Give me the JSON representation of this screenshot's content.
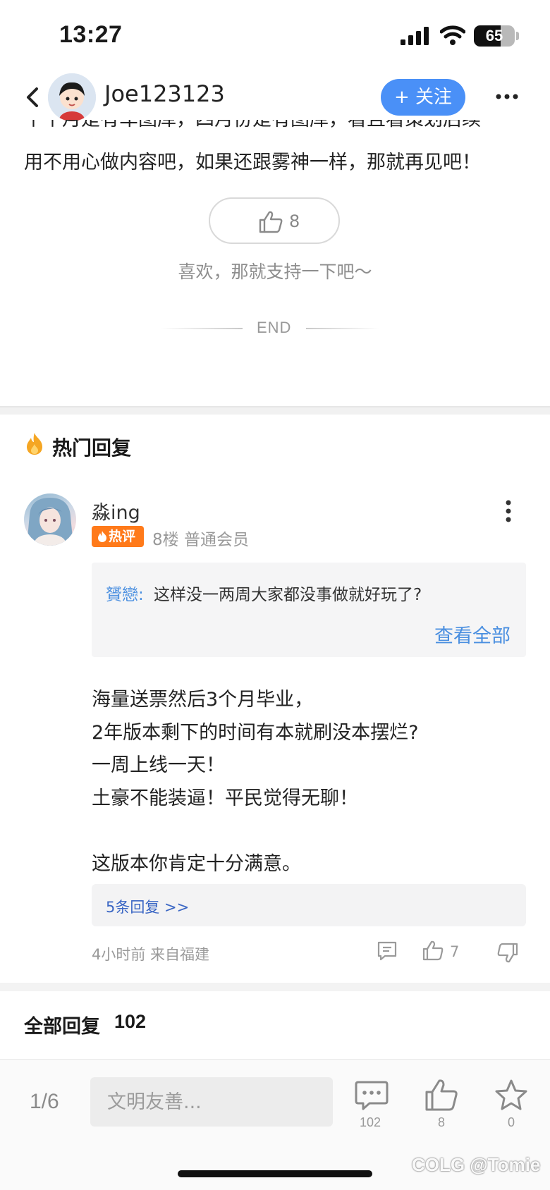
{
  "status_bar": {
    "time": "13:27",
    "battery": "65"
  },
  "header": {
    "author_name": "Joe123123",
    "follow_label": "+ 关注"
  },
  "article": {
    "cut_line": "个个月是有车图库，四月份是有图库，看且看策划后续",
    "last_line": "用不用心做内容吧，如果还跟雾神一样，那就再见吧！",
    "like_count": "8",
    "support_text": "喜欢，那就支持一下吧～",
    "end_text": "END"
  },
  "hot_replies": {
    "title": "热门回复",
    "comment": {
      "author": "淼ing",
      "badge": "热评",
      "meta": "8楼 普通会员",
      "quote": {
        "user": "贇戀:",
        "text": "这样没一两周大家都没事做就好玩了?",
        "view_all": "查看全部"
      },
      "body_lines": [
        "海量送票然后3个月毕业，",
        "2年版本剩下的时间有本就刷没本摆烂?",
        "一周上线一天！",
        "土豪不能装逼！平民觉得无聊！",
        "",
        "这版本你肯定十分满意。"
      ],
      "replies_link": "5条回复 >>",
      "time_location": "4小时前 来自福建",
      "like_count": "7"
    }
  },
  "all_replies": {
    "title": "全部回复",
    "count": "102"
  },
  "bottom_bar": {
    "page_indicator": "1/6",
    "input_placeholder": "文明友善...",
    "comment_count": "102",
    "like_count": "8",
    "favorite_count": "0"
  },
  "watermark": "COLG @Tomie"
}
